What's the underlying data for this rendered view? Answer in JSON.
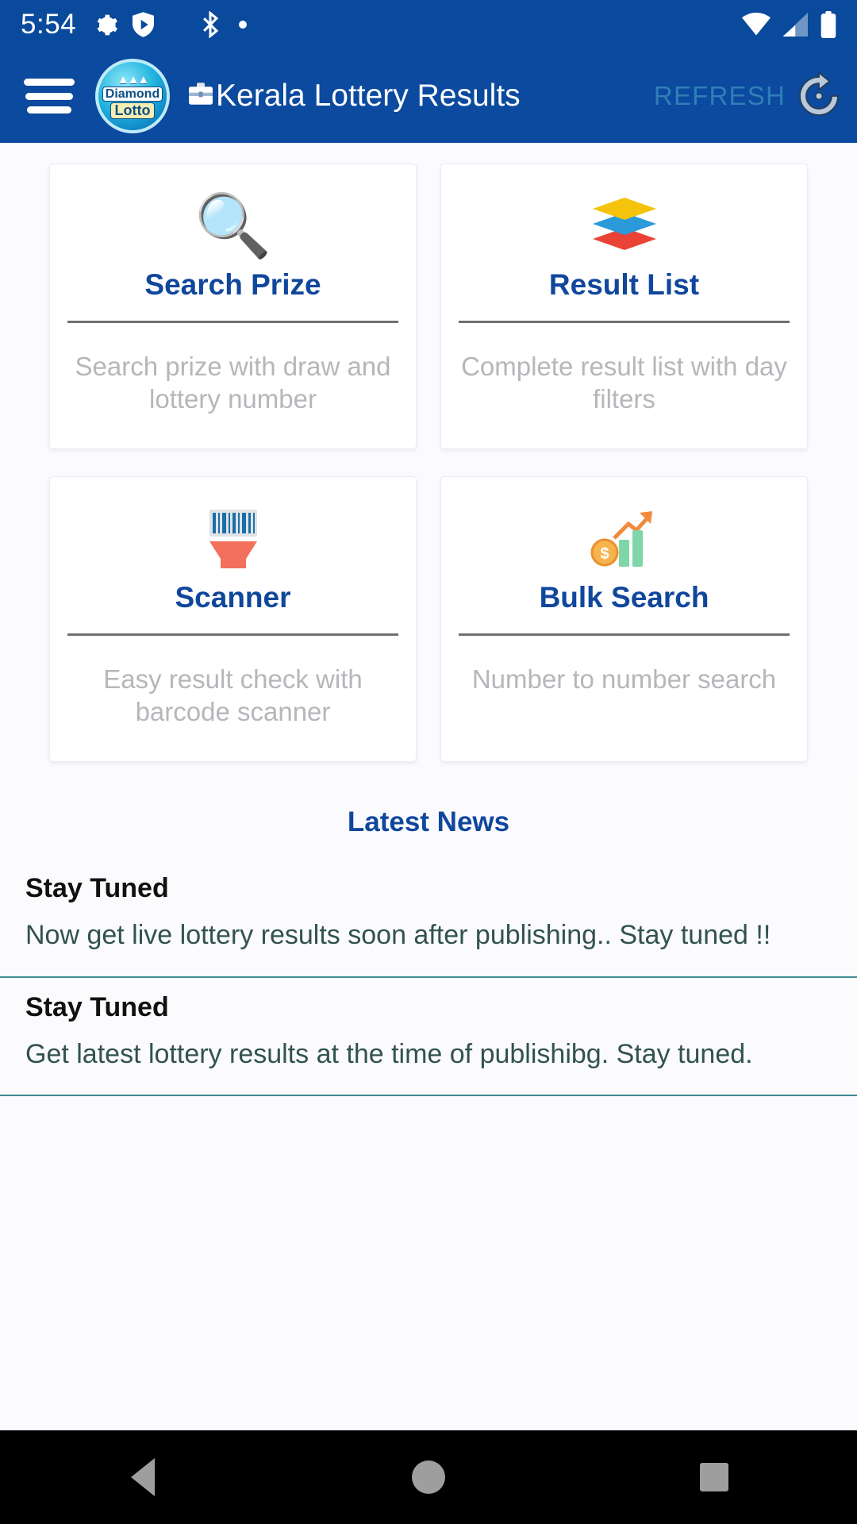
{
  "status_bar": {
    "time": "5:54",
    "left_icons": [
      "gear-icon",
      "shield-play-icon"
    ],
    "mid_icons": [
      "bluetooth-icon",
      "dot-icon"
    ],
    "right_icons": [
      "wifi-icon",
      "signal-icon",
      "battery-icon"
    ]
  },
  "app_bar": {
    "menu_icon": "hamburger-menu-icon",
    "logo": {
      "crown": "▲▲▲",
      "line1": "Diamond",
      "line2": "Lotto"
    },
    "title_icon": "briefcase-icon",
    "title": "Kerala Lottery Results",
    "refresh_label": "REFRESH",
    "refresh_icon": "refresh-circle-icon"
  },
  "cards": [
    {
      "icon": "🔍",
      "icon_name": "magnifying-glass-icon",
      "title": "Search Prize",
      "desc": "Search prize with draw and lottery number"
    },
    {
      "icon": "📑",
      "icon_name": "layers-stack-icon",
      "title": "Result List",
      "desc": "Complete result list with day filters"
    },
    {
      "icon": "📇",
      "icon_name": "barcode-scanner-icon",
      "title": "Scanner",
      "desc": "Easy result check with barcode scanner"
    },
    {
      "icon": "📈",
      "icon_name": "chart-money-icon",
      "title": "Bulk Search",
      "desc": "Number to number search"
    }
  ],
  "news": {
    "heading": "Latest News",
    "items": [
      {
        "title": "Stay Tuned",
        "body": "Now get live lottery results soon after publishing.. Stay tuned !!"
      },
      {
        "title": "Stay Tuned",
        "body": "Get latest lottery results at the time of publishibg. Stay tuned."
      }
    ]
  },
  "nav_bar": {
    "back": "back-button",
    "home": "home-button",
    "recents": "recents-button"
  },
  "colors": {
    "app_bar_blue": "#0b4a9e",
    "status_bar_blue": "#0a4a9c",
    "title_blue": "#10479c",
    "refresh_blue": "#2f7fb8",
    "desc_grey": "#b6b6bb",
    "news_body_green": "#32534c",
    "divider_teal": "#3f8a92"
  }
}
